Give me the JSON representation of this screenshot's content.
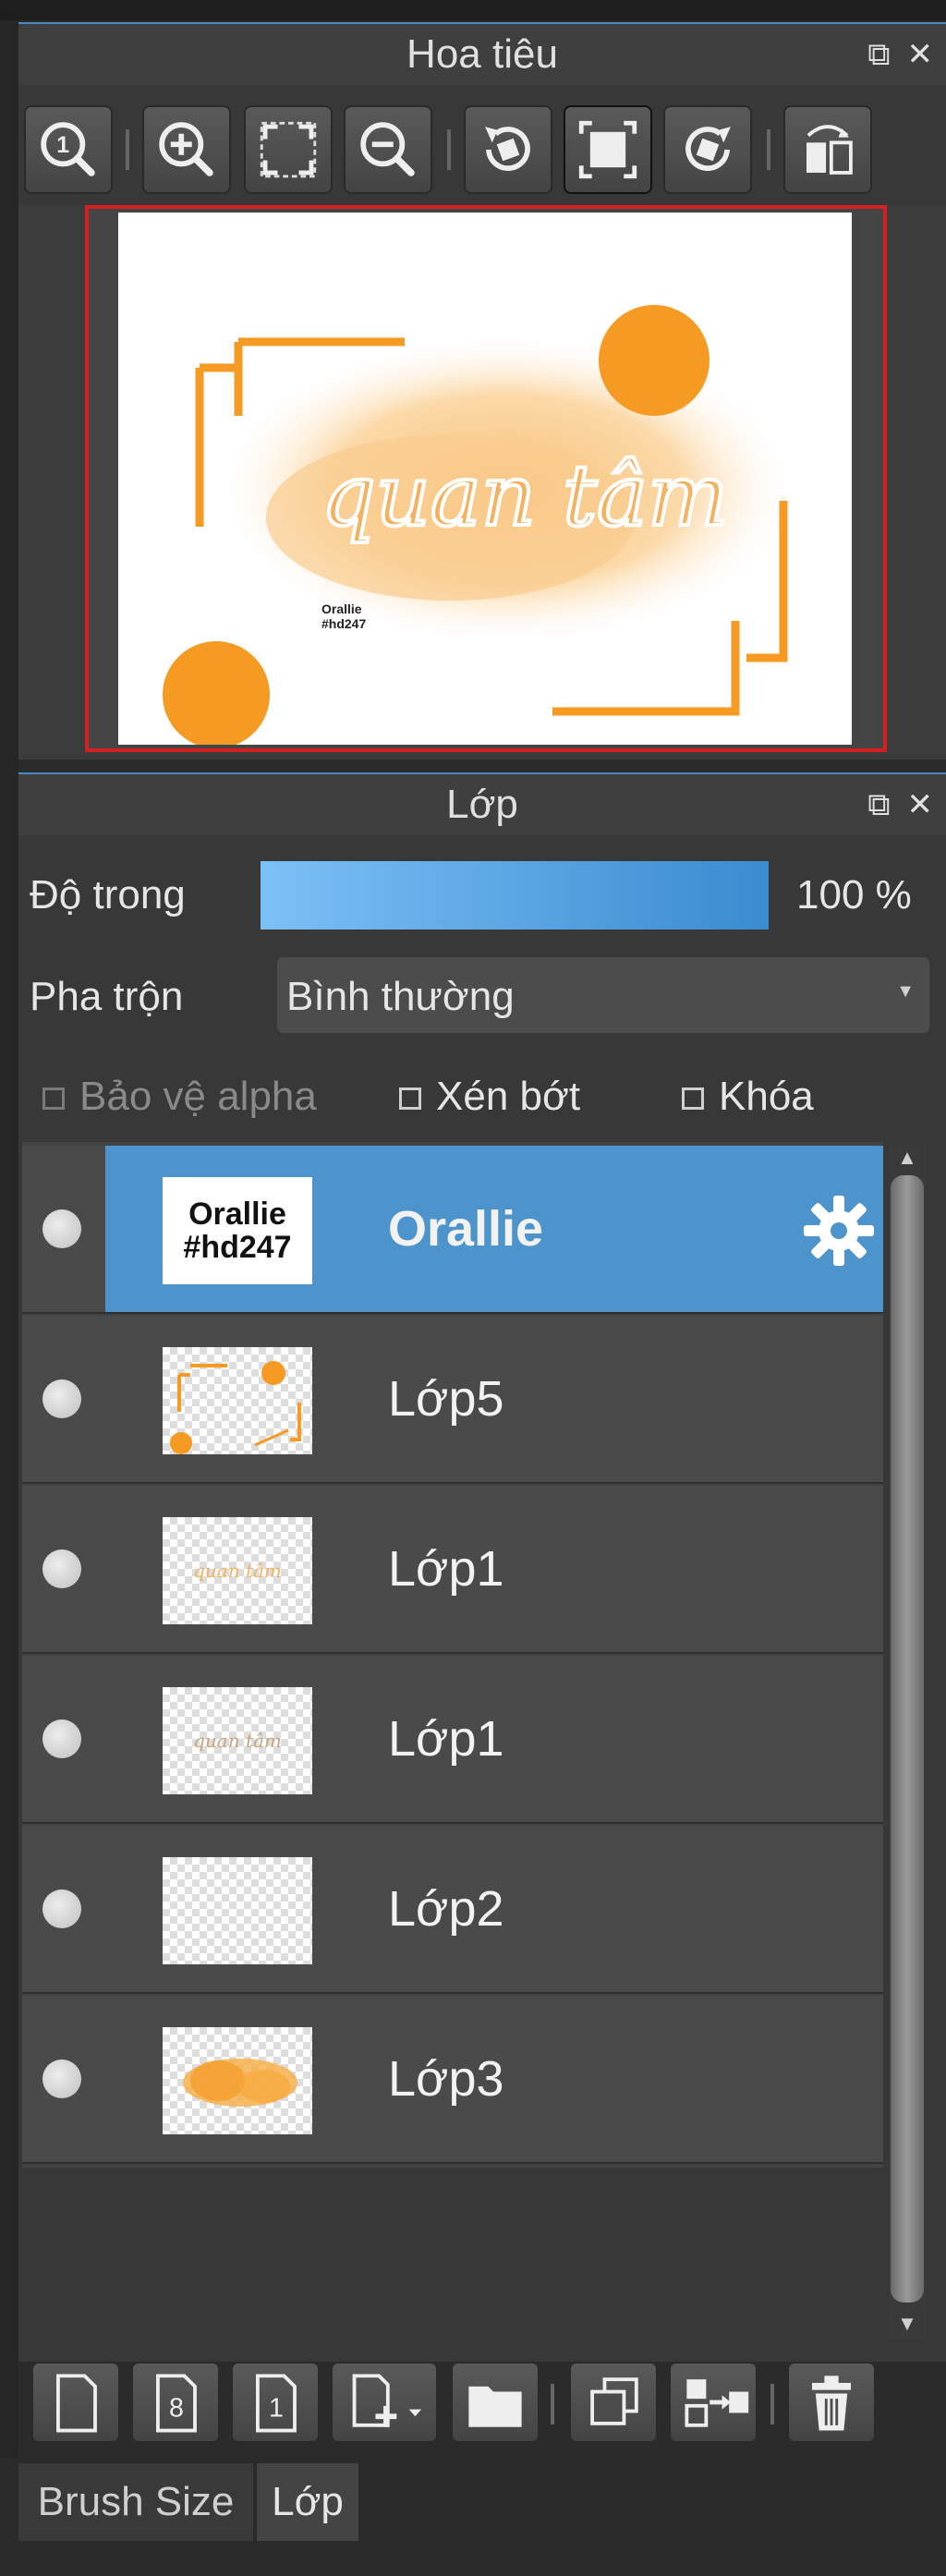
{
  "navigator": {
    "title": "Hoa tiêu",
    "toolbar": [
      "zoom-actual-icon",
      "zoom-in-icon",
      "fit-screen-icon",
      "zoom-out-icon",
      "rotate-left-icon",
      "reset-view-icon",
      "rotate-right-icon",
      "flip-icon"
    ],
    "preview": {
      "title_text": "quan tâm",
      "signature_line1": "Orallie",
      "signature_line2": "#hd247",
      "accent": "#f59a23"
    }
  },
  "layers_panel": {
    "title": "Lớp",
    "opacity_label": "Độ trong",
    "opacity_value": "100 %",
    "opacity_percent": 100,
    "blend_label": "Pha trộn",
    "blend_value": "Bình thường",
    "protect_alpha": "Bảo vệ alpha",
    "clip": "Xén bớt",
    "lock": "Khóa",
    "selected_color": "#4e94cc",
    "layers": [
      {
        "name": "Orallie",
        "thumb_line1": "Orallie",
        "thumb_line2": "#hd247",
        "selected": true
      },
      {
        "name": "Lớp5",
        "selected": false
      },
      {
        "name": "Lớp1",
        "thumb_text": "quan tâm",
        "selected": false
      },
      {
        "name": "Lớp1",
        "thumb_text": "quan tâm",
        "selected": false
      },
      {
        "name": "Lớp2",
        "selected": false
      },
      {
        "name": "Lớp3",
        "selected": false
      }
    ]
  },
  "bottom_toolbar": [
    "new-layer-icon",
    "new-8bit-layer-icon",
    "new-1bit-layer-icon",
    "add-layer-menu-icon",
    "new-folder-icon",
    "duplicate-layer-icon",
    "merge-layer-icon",
    "delete-layer-icon"
  ],
  "tabs": {
    "brush_size": "Brush Size",
    "layer": "Lớp"
  }
}
